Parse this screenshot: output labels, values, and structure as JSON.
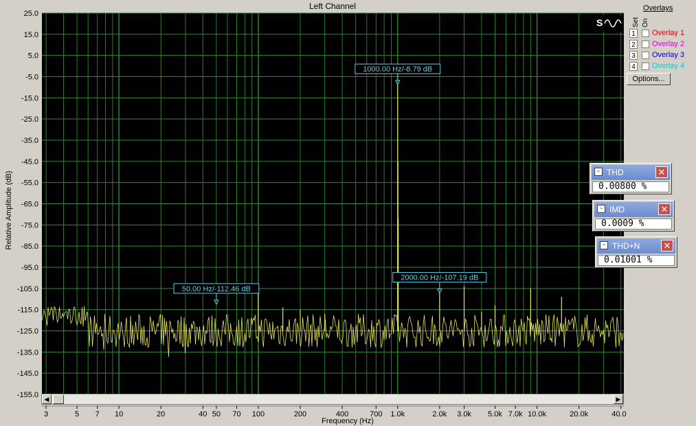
{
  "window": {
    "title": "Left Channel"
  },
  "overlays": {
    "title": "Overlays",
    "set_header": "Set",
    "on_header": "On",
    "items": [
      {
        "num": "1",
        "label": "Overlay 1",
        "color": "#e00000",
        "checked": false
      },
      {
        "num": "2",
        "label": "Overlay 2",
        "color": "#e000e0",
        "checked": false
      },
      {
        "num": "3",
        "label": "Overlay 3",
        "color": "#0000d0",
        "checked": false
      },
      {
        "num": "4",
        "label": "Overlay 4",
        "color": "#00d0d0",
        "checked": false
      }
    ],
    "options_label": "Options..."
  },
  "meters": [
    {
      "name": "THD",
      "value": "0.00800 %"
    },
    {
      "name": "IMD",
      "value": "0.0009 %"
    },
    {
      "name": "THD+N",
      "value": "0.01001 %"
    }
  ],
  "chart_data": {
    "type": "line",
    "title": "Left Channel",
    "xlabel": "Frequency (Hz)",
    "ylabel": "Relative Amplitude (dB)",
    "xscale": "log",
    "xlim": [
      2.8,
      42000
    ],
    "ylim": [
      -155,
      25
    ],
    "grid": true,
    "background": "#000000",
    "grid_color": "#2e8b2e",
    "trace_color": "#e8e85a",
    "y_ticks": [
      "25.0",
      "15.0",
      "5.0",
      "-5.0",
      "-15.0",
      "-25.0",
      "-35.0",
      "-45.0",
      "-55.0",
      "-65.0",
      "-75.0",
      "-85.0",
      "-95.0",
      "-105.0",
      "-115.0",
      "-125.0",
      "-135.0",
      "-145.0",
      "-155.0"
    ],
    "x_ticks": [
      {
        "v": 3,
        "label": "3"
      },
      {
        "v": 5,
        "label": "5"
      },
      {
        "v": 7,
        "label": "7"
      },
      {
        "v": 10,
        "label": "10"
      },
      {
        "v": 20,
        "label": "20"
      },
      {
        "v": 40,
        "label": "40"
      },
      {
        "v": 50,
        "label": "50"
      },
      {
        "v": 70,
        "label": "70"
      },
      {
        "v": 100,
        "label": "100"
      },
      {
        "v": 200,
        "label": "200"
      },
      {
        "v": 400,
        "label": "400"
      },
      {
        "v": 700,
        "label": "700"
      },
      {
        "v": 1000,
        "label": "1.0k"
      },
      {
        "v": 2000,
        "label": "2.0k"
      },
      {
        "v": 3000,
        "label": "3.0k"
      },
      {
        "v": 5000,
        "label": "5.0k"
      },
      {
        "v": 7000,
        "label": "7.0k"
      },
      {
        "v": 10000,
        "label": "10.0k"
      },
      {
        "v": 20000,
        "label": "20.0k"
      },
      {
        "v": 40000,
        "label": "40.0k"
      }
    ],
    "markers": [
      {
        "x": 1000,
        "y": -8.79,
        "label": "1000.00 Hz/-8.79 dB"
      },
      {
        "x": 50,
        "y": -112.46,
        "label": "50.00 Hz/-112.46 dB"
      },
      {
        "x": 2000,
        "y": -107.19,
        "label": "2000.00 Hz/-107.19 dB"
      }
    ],
    "peaks": [
      {
        "x": 1000,
        "y": -8.79
      },
      {
        "x": 1005,
        "y": -45
      },
      {
        "x": 1010,
        "y": -72
      },
      {
        "x": 100,
        "y": -103
      },
      {
        "x": 150,
        "y": -114
      },
      {
        "x": 200,
        "y": -115
      },
      {
        "x": 300,
        "y": -117
      },
      {
        "x": 3000,
        "y": -104
      },
      {
        "x": 2000,
        "y": -107.19
      },
      {
        "x": 4000,
        "y": -116
      },
      {
        "x": 5000,
        "y": -113
      },
      {
        "x": 9000,
        "y": -105
      },
      {
        "x": 15000,
        "y": -109
      }
    ],
    "noise_floor_db": -125,
    "noise_spread_db": 8
  }
}
